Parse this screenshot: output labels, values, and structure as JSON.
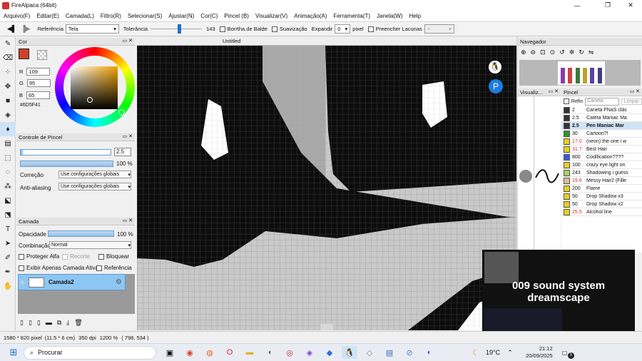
{
  "window": {
    "title": "FireAlpaca (64bit)",
    "minimize": "—",
    "maximize": "❐",
    "close": "✕"
  },
  "menu": [
    "Arquivo(F)",
    "Editar(E)",
    "Camada(L)",
    "Filtro(R)",
    "Selecionar(S)",
    "Ajustar(N)",
    "Cor(C)",
    "Pincel (B)",
    "Visualizar(V)",
    "Animação(A)",
    "Ferramenta(T)",
    "Janela(W)",
    "Help"
  ],
  "toolbar": {
    "reference_label": "Referência",
    "reference_value": "Tela",
    "tolerance_label": "Tolerância",
    "tolerance_value": "143",
    "tolerance_fraction": 0.56,
    "bucket_border": "Borrtha de Balde",
    "antialias": "Suavização",
    "expand_label": "Expandir",
    "expand_value": "0",
    "expand_unit": "pixel",
    "fill_gaps": "Preencher Lacunas",
    "fill_gaps_value": "+"
  },
  "color_panel": {
    "title": "Cor",
    "r_label": "R",
    "r": "109",
    "g_label": "G",
    "g": "95",
    "b_label": "B",
    "b": "65",
    "hex": "#6D5F41",
    "primary_color": "#d04028"
  },
  "brush_control": {
    "title": "Controle de Pincel",
    "size": "2.5",
    "size_fraction": 0.02,
    "opacity": "100 %",
    "opacity_fraction": 1.0,
    "correction_label": "Correção",
    "correction_value": "Use configurações globais",
    "antialias_label": "Anti-aliasing",
    "antialias_value": "Use configurações globais"
  },
  "layer_panel": {
    "title": "Camada",
    "opacity_label": "Opacidade",
    "opacity_value": "100 %",
    "blend_label": "Combinação",
    "blend_value": "Normal",
    "protect_alpha": "Proteger Alfa",
    "clip": "Recorte",
    "lock": "Bloquear",
    "show_active_only": "Exibir Apenas Camada Ativa",
    "reference": "Referência",
    "layers": [
      {
        "name": "Camada2"
      }
    ]
  },
  "canvas": {
    "tab_title": "Untitled"
  },
  "navigator": {
    "title": "Navegador"
  },
  "visualizer": {
    "title": "Visualiz..."
  },
  "brush_panel": {
    "title": "Pincel",
    "refine_label": "Refin",
    "search_placeholder": "Caneta",
    "clear_label": "Limpar",
    "brushes": [
      {
        "size": "2",
        "name": "Caneta FNaS clás",
        "color": "#333333"
      },
      {
        "size": "2.5",
        "name": "Cateta Maniac Ma",
        "color": "#333333"
      },
      {
        "size": "2.5",
        "name": "Pen Maniac Mar",
        "color": "#333333",
        "selected": true
      },
      {
        "size": "30",
        "name": "Cartoon?!",
        "color": "#2a9a2a"
      },
      {
        "size": "17.0",
        "name": "(neon) the one i w",
        "color": "#e8d020",
        "red": true
      },
      {
        "size": "31.7",
        "name": "Best Hair",
        "color": "#e8d020",
        "red": true
      },
      {
        "size": "800",
        "name": "Codification????",
        "color": "#3a5ad8"
      },
      {
        "size": "100",
        "name": "crazy eye light on",
        "color": "#e8d020"
      },
      {
        "size": "243",
        "name": "Shadowing i guess",
        "color": "#a8d060"
      },
      {
        "size": "19.6",
        "name": "Messy Hair2 (Fille",
        "color": "#d8c090",
        "red": true
      },
      {
        "size": "200",
        "name": "Flame",
        "color": "#e8d020"
      },
      {
        "size": "50",
        "name": "Drop Shadow x3",
        "color": "#e8d020"
      },
      {
        "size": "50",
        "name": "Drop Shadow x2",
        "color": "#e8d020"
      },
      {
        "size": "25.5",
        "name": "Alcohol line",
        "color": "#e8d020",
        "red": true
      }
    ]
  },
  "stream": {
    "line1": "009 sound system",
    "line2": "dreamscape"
  },
  "status": {
    "size": "1580 * 820 pixel",
    "cm": "(11.5 * 6 cm)",
    "dpi": "350 dpi",
    "zoom": "1200 %",
    "coords": "( 798, 534 )"
  },
  "taskbar": {
    "search": "Procurar",
    "temperature": "19°C",
    "time": "21:12",
    "date": "20/09/2025",
    "notifications": "3"
  }
}
